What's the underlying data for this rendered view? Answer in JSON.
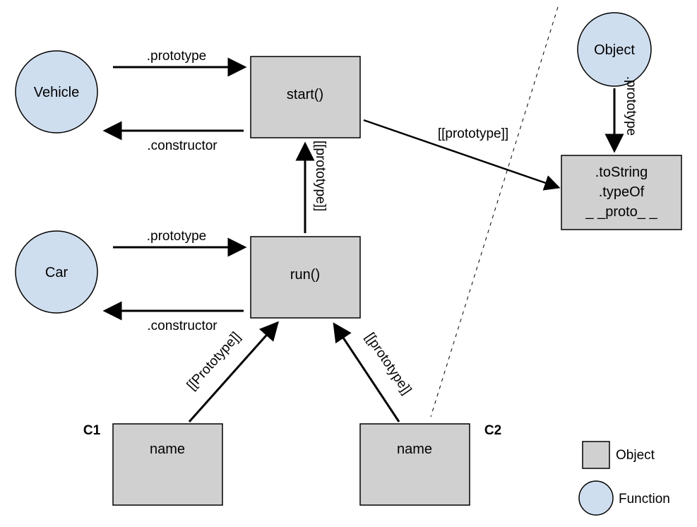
{
  "nodes": {
    "vehicle": {
      "label": "Vehicle"
    },
    "car": {
      "label": "Car"
    },
    "object": {
      "label": "Object"
    },
    "start_box": {
      "label": "start()"
    },
    "run_box": {
      "label": "run()"
    },
    "objproto_box": {
      "line1": ".toString",
      "line2": ".typeOf",
      "line3": "_ _proto_ _"
    },
    "c1_box": {
      "label": "name",
      "tag": "C1"
    },
    "c2_box": {
      "label": "name",
      "tag": "C2"
    }
  },
  "edges": {
    "vehicle_to_start": ".prototype",
    "start_to_vehicle": ".constructor",
    "car_to_run": ".prototype",
    "run_to_car": ".constructor",
    "run_to_start": "[[prototype]]",
    "start_to_objproto": "[[prototype]]",
    "object_to_objproto": ".prototype",
    "c1_to_run": "[[Prototype]]",
    "c2_to_run": "[[prototype]]"
  },
  "legend": {
    "object": "Object",
    "function": "Function"
  },
  "colors": {
    "circle_fill": "#cfdeef",
    "box_fill": "#d0d0d0",
    "stroke": "#000000"
  }
}
